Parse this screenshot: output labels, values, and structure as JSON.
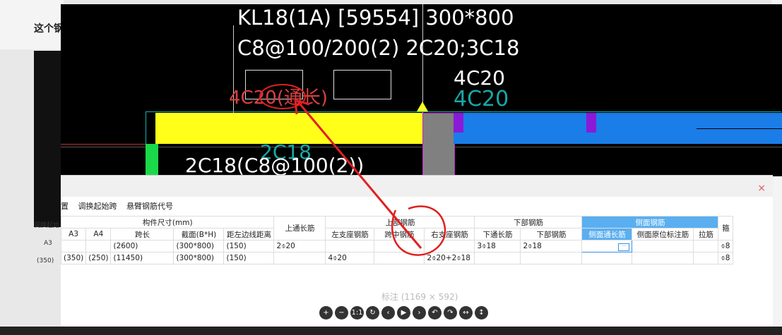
{
  "background": {
    "question_title": "这个钢",
    "side_label": "调换起始",
    "side_cells": [
      "A3",
      "(350)"
    ]
  },
  "cad": {
    "line1": "KL18(1A) [59554] 300*800",
    "line2": "C8@100/200(2) 2C20;3C18",
    "right_top": "4C20",
    "right_cyan": "4C20",
    "left_red": "4C20(通长)",
    "bottom_left": "2C18(C8@100(2))",
    "cyan_mid": "2C18"
  },
  "dialog": {
    "toolbar": [
      "置",
      "调换起始跨",
      "悬臂钢筋代号"
    ],
    "group_headers": {
      "size": "构件尺寸(mm)",
      "top_through": "上通长筋",
      "top": "上部钢筋",
      "bottom": "下部钢筋",
      "side": "侧面钢筋",
      "extra": "箍"
    },
    "columns": [
      "A3",
      "A4",
      "跨长",
      "截面(B*H)",
      "距左边线距离",
      "左支座钢筋",
      "跨中钢筋",
      "右支座钢筋",
      "下通长筋",
      "下部钢筋",
      "侧面通长筋",
      "侧面原位标注筋",
      "拉筋"
    ],
    "rows": [
      {
        "a3": "",
        "a4": "",
        "span": "(2600)",
        "section": "(300*800)",
        "dist": "(150)",
        "top_through": "2⌽20",
        "left": "",
        "mid": "",
        "right": "",
        "bot_through": "3⌽18",
        "bottom": "2⌽18",
        "side_through": "",
        "side_local": "",
        "tie": "",
        "extra": "⌽8"
      },
      {
        "a3": "(350)",
        "a4": "(250)",
        "span": "(11450)",
        "section": "(300*800)",
        "dist": "(150)",
        "top_through": "",
        "left": "4⌽20",
        "mid": "",
        "right": "2⌽20+2⌽18",
        "bot_through": "",
        "bottom": "",
        "side_through": "",
        "side_local": "",
        "tie": "",
        "extra": "⌽8"
      }
    ],
    "ellipsis": "···",
    "close": "×"
  },
  "viewer": {
    "caption": "标注 (1169 × 592)",
    "controls": [
      "+",
      "−",
      "1:1",
      "↻",
      "‹",
      "▶",
      "›",
      "↶",
      "↷",
      "↔",
      "↕"
    ]
  }
}
